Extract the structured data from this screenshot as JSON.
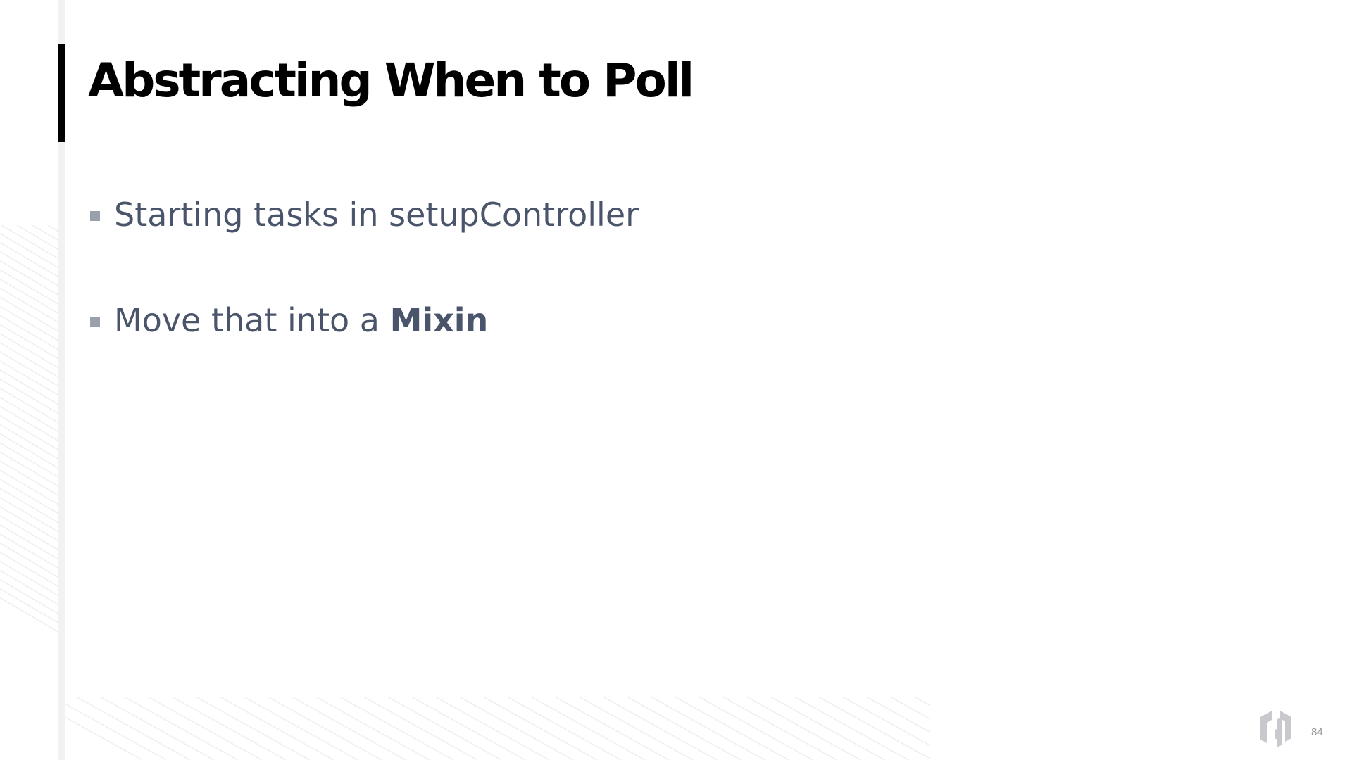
{
  "slide": {
    "title": "Abstracting When to Poll",
    "bullets": [
      {
        "text": "Starting tasks in setupController",
        "strong": ""
      },
      {
        "text": "Move that into a ",
        "strong": "Mixin"
      }
    ],
    "page_number": "84",
    "logo_icon": "hashicorp-logo-icon",
    "colors": {
      "title": "#000000",
      "body_text": "#4a556b",
      "bullet_marker": "#9aa1ad",
      "accent_bar": "#000000",
      "rail": "#f2f2f3",
      "logo": "#c7c9cc",
      "page_number": "#9a9a9a"
    }
  }
}
